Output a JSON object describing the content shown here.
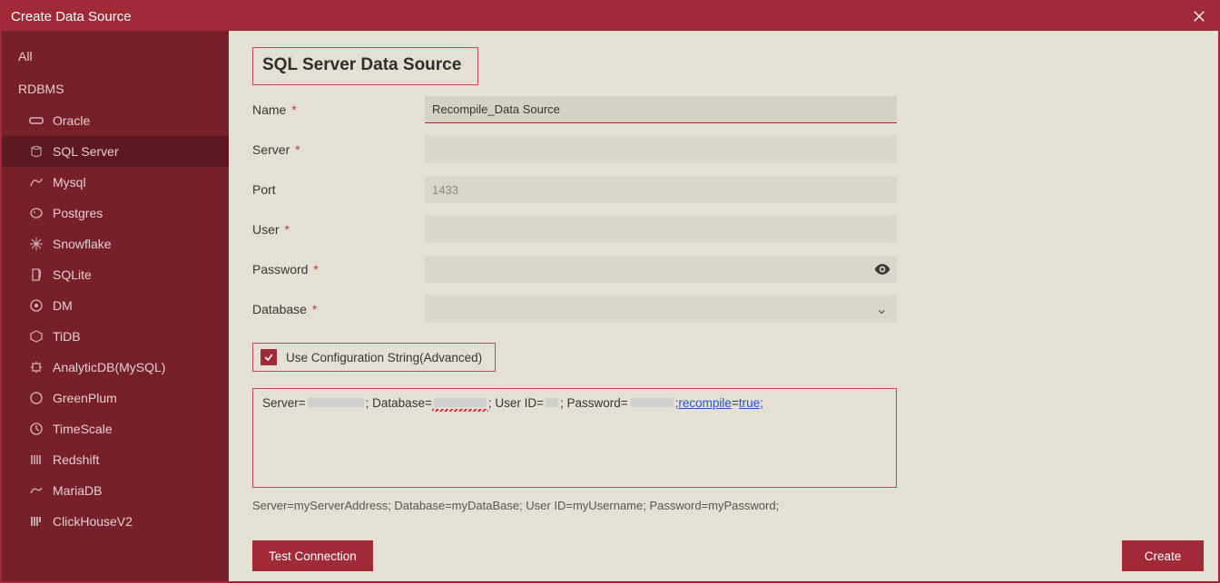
{
  "window": {
    "title": "Create Data Source"
  },
  "sidebar": {
    "all": "All",
    "section": "RDBMS",
    "items": [
      {
        "label": "Oracle"
      },
      {
        "label": "SQL Server",
        "selected": true
      },
      {
        "label": "Mysql"
      },
      {
        "label": "Postgres"
      },
      {
        "label": "Snowflake"
      },
      {
        "label": "SQLite"
      },
      {
        "label": "DM"
      },
      {
        "label": "TiDB"
      },
      {
        "label": "AnalyticDB(MySQL)"
      },
      {
        "label": "GreenPlum"
      },
      {
        "label": "TimeScale"
      },
      {
        "label": "Redshift"
      },
      {
        "label": "MariaDB"
      },
      {
        "label": "ClickHouseV2"
      }
    ]
  },
  "form": {
    "title": "SQL Server Data Source",
    "name_label": "Name",
    "name_value": "Recompile_Data Source",
    "server_label": "Server",
    "server_value": "",
    "port_label": "Port",
    "port_value": "",
    "port_placeholder": "1433",
    "user_label": "User",
    "user_value": "",
    "password_label": "Password",
    "password_value": "",
    "database_label": "Database",
    "database_value": "",
    "config_checkbox_label": "Use Configuration String(Advanced)",
    "config_checkbox_checked": true,
    "conn_template": {
      "p1": "Server=",
      "p2": "; Database=",
      "p3": "; User ID=",
      "p4": "; Password=",
      "k1": ";recompile",
      "eq": "=",
      "k2": "true;"
    },
    "hint": "Server=myServerAddress; Database=myDataBase; User ID=myUsername; Password=myPassword;"
  },
  "footer": {
    "test_connection": "Test Connection",
    "create": "Create"
  }
}
